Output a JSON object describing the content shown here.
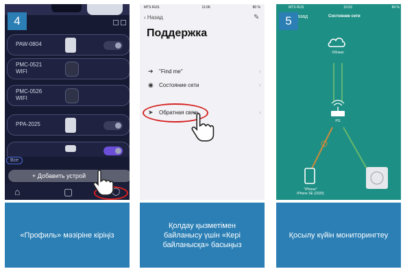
{
  "panels": [
    {
      "step": "4",
      "devices": [
        {
          "name": "PAW-0804",
          "line2": ""
        },
        {
          "name": "PMC-0521",
          "line2": "WIFI"
        },
        {
          "name": "PMC-0526",
          "line2": "WIFI"
        },
        {
          "name": "PPA-2025",
          "line2": ""
        }
      ],
      "filter_label": "Все",
      "add_button": "+ Добавить устрой",
      "caption": "«Профиль» мәзіріне кіріңіз"
    },
    {
      "status_carrier": "MTS RUS",
      "status_time": "11:06",
      "status_battery": "80 %",
      "back_label": "Назад",
      "title": "Поддержка",
      "items": [
        {
          "label": "\"Find me\"",
          "icon": "location-arrow-icon"
        },
        {
          "label": "Состояние сети",
          "icon": "compass-icon"
        },
        {
          "label": "Обратная связь",
          "icon": "send-icon"
        }
      ],
      "caption": "Қолдау қызметімен байланысу үшін «Кері байланысқа» басыңыз"
    },
    {
      "step": "5",
      "status_carrier": "MTS RUS",
      "status_time": "10:53",
      "status_battery": "84 %",
      "back_label": "Назад",
      "nav_title": "Состояние сети",
      "cloud_label": "Облако",
      "router_label": "PG",
      "phone_label_1": "\"iPhone\"",
      "phone_label_2": "iPhone SE (2020)",
      "caption": "Қосылу күйін мониторингтеу"
    }
  ],
  "colors": {
    "caption_bg": "#2b7fb5",
    "panel3_bg": "#1d8f84",
    "highlight": "#d62020",
    "link_orange": "#d08a3c",
    "link_green": "#69b86c"
  }
}
